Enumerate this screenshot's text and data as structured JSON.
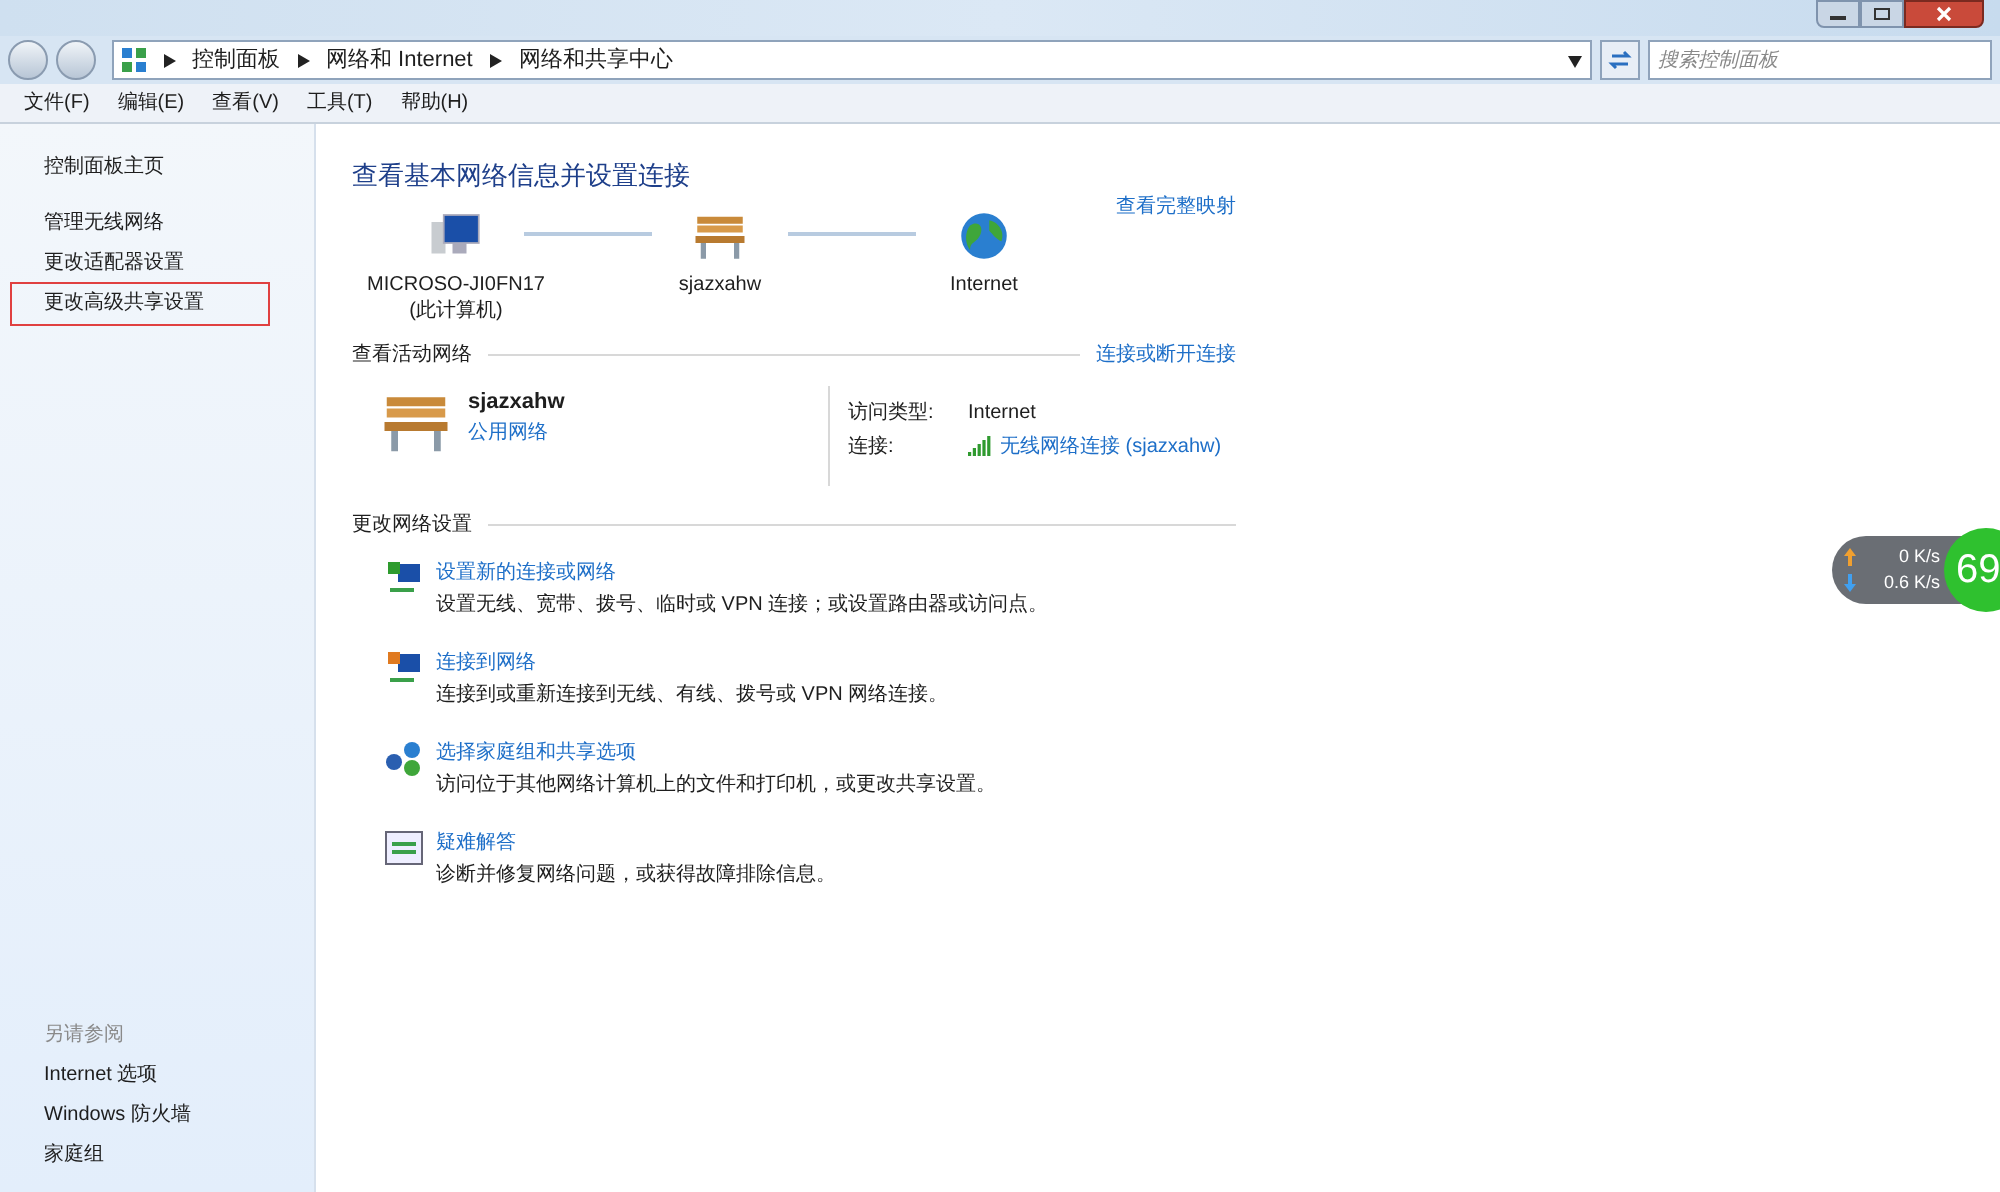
{
  "address_bar": {
    "breadcrumbs": [
      "控制面板",
      "网络和 Internet",
      "网络和共享中心"
    ],
    "search_placeholder": "搜索控制面板"
  },
  "menu": [
    "文件(F)",
    "编辑(E)",
    "查看(V)",
    "工具(T)",
    "帮助(H)"
  ],
  "sidebar": {
    "items": [
      {
        "label": "控制面板主页",
        "highlighted": false
      },
      {
        "label": "管理无线网络",
        "highlighted": false
      },
      {
        "label": "更改适配器设置",
        "highlighted": false
      },
      {
        "label": "更改高级共享设置",
        "highlighted": true
      }
    ],
    "see_also_title": "另请参阅",
    "see_also": [
      "Internet 选项",
      "Windows 防火墙",
      "家庭组"
    ]
  },
  "main": {
    "title": "查看基本网络信息并设置连接",
    "map_link": "查看完整映射",
    "map_nodes": [
      {
        "kind": "computer",
        "label": "MICROSO-JI0FN17",
        "sublabel": "(此计算机)"
      },
      {
        "kind": "bench",
        "label": "sjazxahw"
      },
      {
        "kind": "globe",
        "label": "Internet"
      }
    ],
    "active_title": "查看活动网络",
    "active_link": "连接或断开连接",
    "network": {
      "name": "sjazxahw",
      "type_link": "公用网络",
      "access_label": "访问类型:",
      "access_value": "Internet",
      "conn_label": "连接:",
      "conn_link": "无线网络连接 (sjazxahw)"
    },
    "change_title": "更改网络设置",
    "tasks": [
      {
        "kind": "new",
        "link": "设置新的连接或网络",
        "desc": "设置无线、宽带、拨号、临时或 VPN 连接；或设置路由器或访问点。"
      },
      {
        "kind": "connect",
        "link": "连接到网络",
        "desc": "连接到或重新连接到无线、有线、拨号或 VPN 网络连接。"
      },
      {
        "kind": "homegroup",
        "link": "选择家庭组和共享选项",
        "desc": "访问位于其他网络计算机上的文件和打印机，或更改共享设置。"
      },
      {
        "kind": "troubleshoot",
        "link": "疑难解答",
        "desc": "诊断并修复网络问题，或获得故障排除信息。"
      }
    ]
  },
  "speed_widget": {
    "up": "0",
    "up_unit": "K/s",
    "down": "0.6",
    "down_unit": "K/s",
    "percent": "69"
  }
}
